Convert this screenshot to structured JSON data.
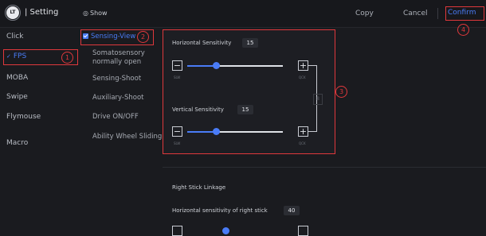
{
  "header": {
    "logo_text": "LT",
    "title": "| Setting",
    "show_label": "Show",
    "copy_label": "Copy",
    "cancel_label": "Cancel",
    "confirm_label": "Confirm"
  },
  "left_nav": {
    "items": [
      {
        "label": "Click"
      },
      {
        "label": "FPS",
        "selected": true
      },
      {
        "label": "MOBA"
      },
      {
        "label": "Swipe"
      },
      {
        "label": "Flymouse"
      },
      {
        "label": "Macro"
      }
    ]
  },
  "sub_nav": {
    "items": [
      {
        "label": "Sensing-View",
        "selected": true
      },
      {
        "label": "Somatosensory normally open"
      },
      {
        "label": "Sensing-Shoot"
      },
      {
        "label": "Auxiliary-Shoot"
      },
      {
        "label": "Drive ON/OFF"
      },
      {
        "label": "Ability Wheel Sliding"
      }
    ]
  },
  "markers": [
    "1",
    "2",
    "3",
    "4"
  ],
  "sensitivity": {
    "horizontal_label": "Horizontal Sensitivity",
    "horizontal_value": "15",
    "horizontal_level": 0.3,
    "vertical_label": "Vertical Sensitivity",
    "vertical_value": "15",
    "vertical_level": 0.3,
    "minus": "−",
    "plus": "+",
    "slow_label": "SLW",
    "quick_label": "QCK",
    "link_label": "8"
  },
  "right_stick": {
    "title": "Right Stick Linkage",
    "horizontal_label": "Horizontal sensitivity of right stick",
    "horizontal_value": "40"
  },
  "colors": {
    "accent": "#4a7cf7",
    "annotation": "#e0383c",
    "background": "#1a1b1f"
  }
}
